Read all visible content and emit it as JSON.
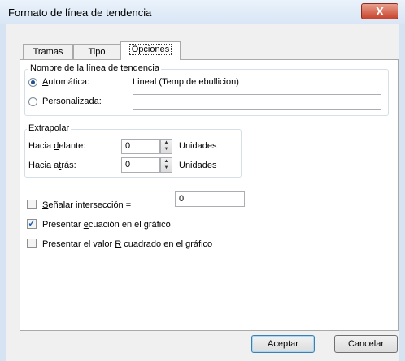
{
  "window": {
    "title": "Formato de línea de tendencia",
    "close_symbol": "X"
  },
  "tabs": [
    {
      "label": "Tramas"
    },
    {
      "label": "Tipo"
    },
    {
      "label": "Opciones"
    }
  ],
  "name_group": {
    "legend": "Nombre de la línea de tendencia",
    "auto": {
      "pre": "",
      "ul": "A",
      "post": "utomática:",
      "value": "Lineal (Temp de ebullicion)",
      "checked": true
    },
    "custom": {
      "pre": "",
      "ul": "P",
      "post": "ersonalizada:",
      "value": "",
      "checked": false
    }
  },
  "extrapolate": {
    "legend": "Extrapolar",
    "forward": {
      "pre": "Hacia ",
      "ul": "d",
      "post": "elante:",
      "value": "0",
      "unit": "Unidades"
    },
    "backward": {
      "pre": "Hacia a",
      "ul": "t",
      "post": "rás:",
      "value": "0",
      "unit": "Unidades"
    }
  },
  "intercept": {
    "pre": "",
    "ul": "S",
    "post": "eñalar intersección =",
    "value": "0",
    "checked": false
  },
  "show_equation": {
    "pre": "Presentar ",
    "ul": "e",
    "post": "cuación en el gráfico",
    "checked": true
  },
  "show_r2": {
    "pre": "Presentar el valor ",
    "ul": "R",
    "post": " cuadrado en el gráfico",
    "checked": false
  },
  "buttons": {
    "ok": "Aceptar",
    "cancel": "Cancelar"
  },
  "icons": {
    "check": "✓",
    "spin_up": "▲",
    "spin_down": "▼"
  }
}
